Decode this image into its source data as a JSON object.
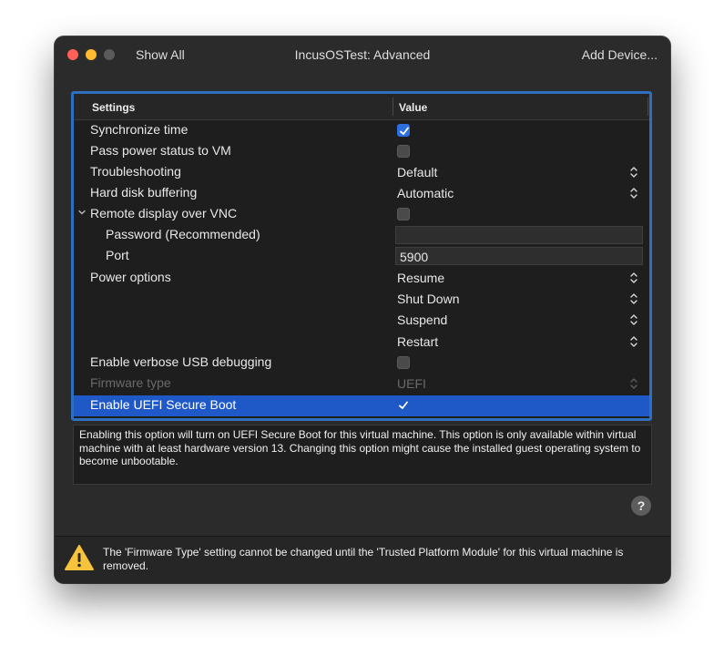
{
  "window": {
    "title": "IncusOSTest: Advanced",
    "show_all": "Show All",
    "add_device": "Add Device..."
  },
  "table": {
    "headers": {
      "settings": "Settings",
      "value": "Value"
    },
    "rows": [
      {
        "label": "Synchronize time",
        "type": "checkbox",
        "checked": true
      },
      {
        "label": "Pass power status to VM",
        "type": "checkbox",
        "checked": false
      },
      {
        "label": "Troubleshooting",
        "type": "select",
        "value": "Default"
      },
      {
        "label": "Hard disk buffering",
        "type": "select",
        "value": "Automatic"
      },
      {
        "label": "Remote display over VNC",
        "type": "checkbox",
        "checked": false,
        "expanded": true
      },
      {
        "label": "Password (Recommended)",
        "type": "text",
        "value": ""
      },
      {
        "label": "Port",
        "type": "text",
        "value": "5900"
      },
      {
        "label": "Power options",
        "type": "select",
        "value": "Resume"
      },
      {
        "label": "",
        "type": "select",
        "value": "Shut Down"
      },
      {
        "label": "",
        "type": "select",
        "value": "Suspend"
      },
      {
        "label": "",
        "type": "select",
        "value": "Restart"
      },
      {
        "label": "Enable verbose USB debugging",
        "type": "checkbox",
        "checked": false
      },
      {
        "label": "Firmware type",
        "type": "select",
        "value": "UEFI",
        "disabled": true
      },
      {
        "label": "Enable UEFI Secure Boot",
        "type": "checkbox",
        "checked": true,
        "selected": true
      }
    ]
  },
  "description": "Enabling this option will turn on UEFI Secure Boot for this virtual machine. This option is only available within virtual machine with at least hardware version 13. Changing this option might cause the installed guest operating system to become unbootable.",
  "help": "?",
  "warning": "The 'Firmware Type' setting cannot be changed until the 'Trusted Platform Module' for this virtual machine is removed.",
  "colors": {
    "accent": "#2d6fe0",
    "selection": "#1f59c8",
    "background": "#2b2b2b"
  }
}
